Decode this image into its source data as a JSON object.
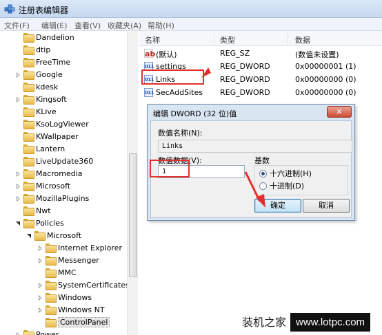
{
  "window": {
    "title": "注册表编辑器"
  },
  "menu": [
    "文件(F)",
    "编辑(E)",
    "查看(V)",
    "收藏夹(A)",
    "帮助(H)"
  ],
  "tree": {
    "items": [
      {
        "label": "Dandelion",
        "arrow": "none",
        "indent": 0
      },
      {
        "label": "dtip",
        "arrow": "none",
        "indent": 0
      },
      {
        "label": "FreeTime",
        "arrow": "none",
        "indent": 0
      },
      {
        "label": "Google",
        "arrow": "right",
        "indent": 0
      },
      {
        "label": "kdesk",
        "arrow": "none",
        "indent": 0
      },
      {
        "label": "Kingsoft",
        "arrow": "right",
        "indent": 0
      },
      {
        "label": "KLive",
        "arrow": "none",
        "indent": 0
      },
      {
        "label": "KsoLogViewer",
        "arrow": "none",
        "indent": 0
      },
      {
        "label": "KWallpaper",
        "arrow": "none",
        "indent": 0
      },
      {
        "label": "Lantern",
        "arrow": "none",
        "indent": 0
      },
      {
        "label": "LiveUpdate360",
        "arrow": "none",
        "indent": 0
      },
      {
        "label": "Macromedia",
        "arrow": "right",
        "indent": 0
      },
      {
        "label": "Microsoft",
        "arrow": "right",
        "indent": 0
      },
      {
        "label": "MozillaPlugins",
        "arrow": "right",
        "indent": 0
      },
      {
        "label": "Nwt",
        "arrow": "none",
        "indent": 0
      },
      {
        "label": "Policies",
        "arrow": "down",
        "indent": 0
      },
      {
        "label": "Microsoft",
        "arrow": "down",
        "indent": 1
      },
      {
        "label": "Internet Explorer",
        "arrow": "right",
        "indent": 2
      },
      {
        "label": "Messenger",
        "arrow": "right",
        "indent": 2
      },
      {
        "label": "MMC",
        "arrow": "none",
        "indent": 2
      },
      {
        "label": "SystemCertificates",
        "arrow": "right",
        "indent": 2
      },
      {
        "label": "Windows",
        "arrow": "right",
        "indent": 2
      },
      {
        "label": "Windows NT",
        "arrow": "right",
        "indent": 2
      },
      {
        "label": "ControlPanel",
        "arrow": "none",
        "indent": 2,
        "selected": true
      },
      {
        "label": "Power",
        "arrow": "right",
        "indent": 0
      }
    ]
  },
  "list": {
    "columns": [
      "名称",
      "类型",
      "数据"
    ],
    "rows": [
      {
        "icon": "string-value-icon",
        "icon_text": "ab",
        "name": "(默认)",
        "type": "REG_SZ",
        "data": "(数值未设置)"
      },
      {
        "icon": "dword-value-icon",
        "icon_text": "011",
        "name": "settings",
        "type": "REG_DWORD",
        "data": "0x00000001 (1)"
      },
      {
        "icon": "dword-value-icon",
        "icon_text": "011",
        "name": "Links",
        "type": "REG_DWORD",
        "data": "0x00000000 (0)"
      },
      {
        "icon": "dword-value-icon",
        "icon_text": "011",
        "name": "SecAddSites",
        "type": "REG_DWORD",
        "data": "0x00000000 (0)"
      }
    ]
  },
  "dialog": {
    "title": "编辑 DWORD (32 位)值",
    "close_label": "✕",
    "name_label": "数值名称(N):",
    "name_value": "Links",
    "data_label": "数值数据(V):",
    "data_value": "1",
    "base_label": "基数",
    "hex_label": "十六进制(H)",
    "dec_label": "十进制(D)",
    "ok_label": "确定",
    "cancel_label": "取消"
  },
  "watermark": {
    "left": "装机之家",
    "right": "www.lotpc.com"
  },
  "colors": {
    "highlight_red": "#e1302b"
  }
}
